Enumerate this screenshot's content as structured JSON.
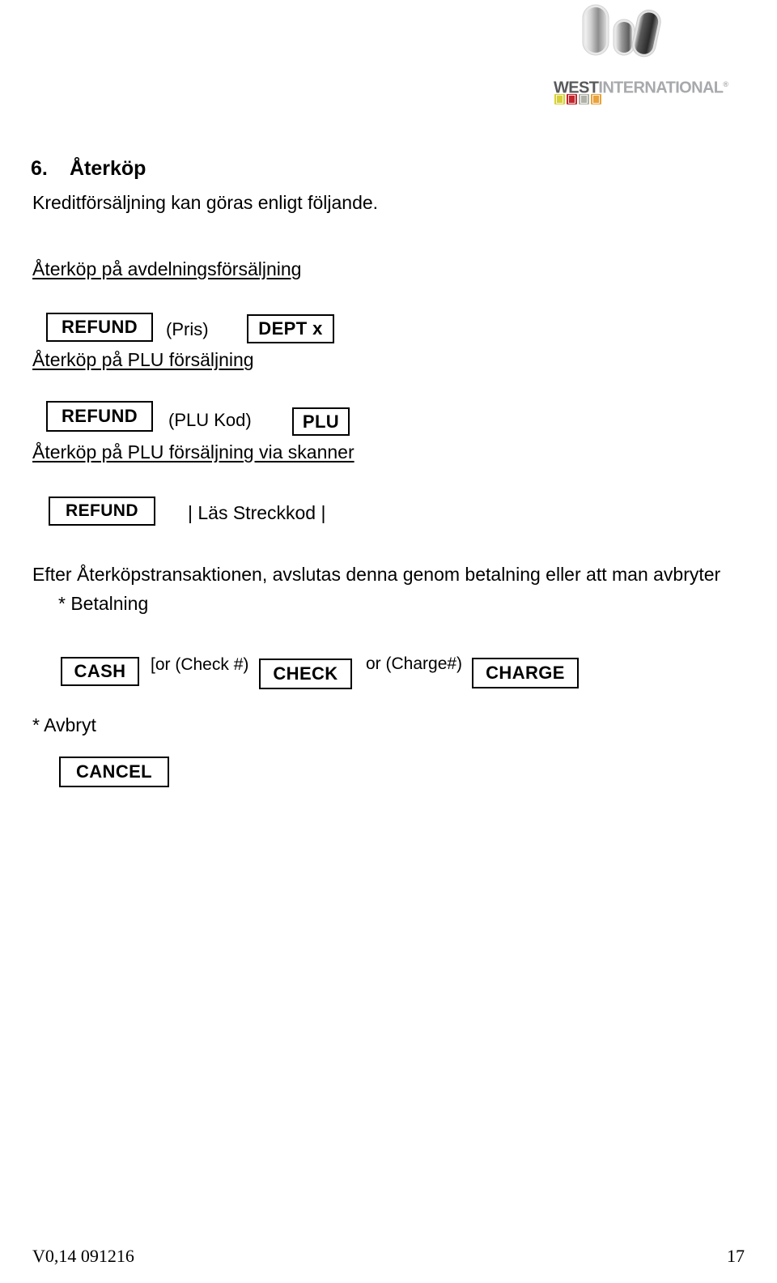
{
  "logo": {
    "word_primary": "WEST",
    "word_secondary": "INTERNATIONAL",
    "registered_mark": "®",
    "primary_color": "#58595b",
    "secondary_color": "#a7a9ac",
    "swatch_colors": [
      "#d7d13a",
      "#c1272d",
      "#b0b2a8",
      "#e8a33d"
    ]
  },
  "section": {
    "number": "6.",
    "title": "Återköp",
    "intro": "Kreditförsäljning kan göras enligt följande."
  },
  "subheads": {
    "dept": "Återköp på avdelningsförsäljning",
    "plu": "Återköp på PLU försäljning",
    "scanner": "Återköp på PLU försäljning via skanner"
  },
  "sequences": {
    "dept": {
      "key1": "REFUND",
      "note1": "(Pris)",
      "key2": "DEPT x"
    },
    "plu": {
      "key1": "REFUND",
      "note1": "(PLU Kod)",
      "key2": "PLU"
    },
    "scanner": {
      "key1": "REFUND",
      "note1": "| Läs Streckkod |"
    }
  },
  "closing": {
    "paragraph": "Efter Återköpstransaktionen, avslutas denna genom betalning eller att man avbryter",
    "payment_label": "* Betalning",
    "cancel_label": "* Avbryt"
  },
  "payment_row": {
    "cash_key": "CASH",
    "check_note": "[or (Check #)",
    "check_key": "CHECK",
    "charge_note": "or (Charge#)",
    "charge_key": "CHARGE"
  },
  "cancel_row": {
    "cancel_key": "CANCEL"
  },
  "footer": {
    "version": "V0,14 091216",
    "page_number": "17"
  }
}
